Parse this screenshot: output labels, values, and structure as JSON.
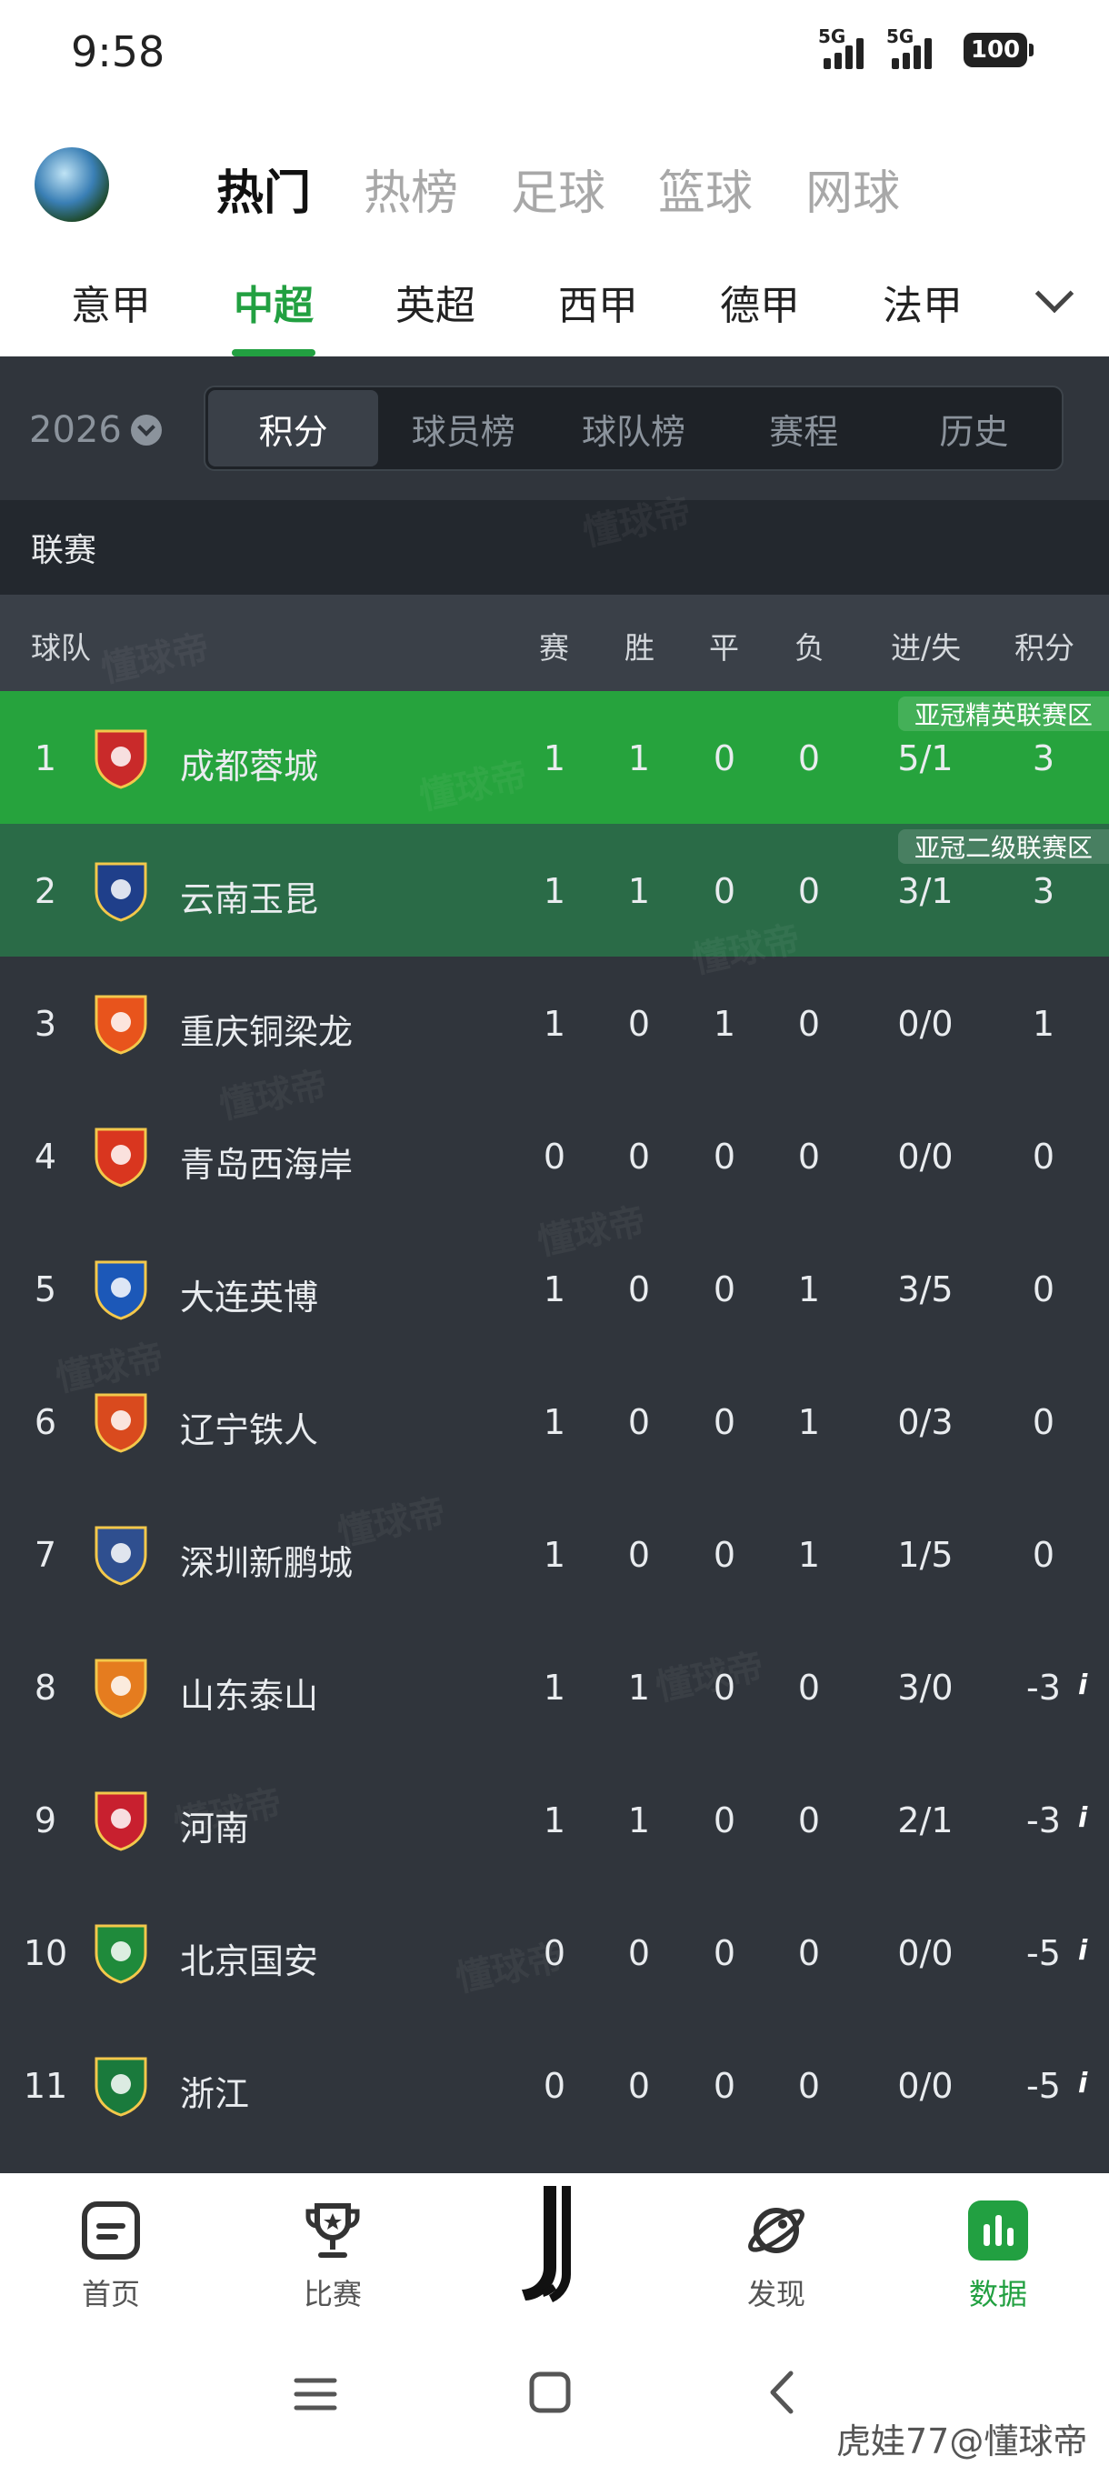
{
  "status": {
    "time": "9:58",
    "signal1": "5G",
    "signal2": "5G",
    "battery": "100"
  },
  "primary_tabs": [
    "热门",
    "热榜",
    "足球",
    "篮球",
    "网球"
  ],
  "league_tabs": [
    "意甲",
    "中超",
    "英超",
    "西甲",
    "德甲",
    "法甲"
  ],
  "season": "2026",
  "segments": [
    "积分",
    "球员榜",
    "球队榜",
    "赛程",
    "历史"
  ],
  "section_title": "联赛",
  "columns": {
    "team": "球队",
    "played": "赛",
    "won": "胜",
    "draw": "平",
    "lost": "负",
    "goals": "进/失",
    "points": "积分"
  },
  "rows": [
    {
      "rank": "1",
      "team": "成都蓉城",
      "played": "1",
      "won": "1",
      "draw": "0",
      "lost": "0",
      "goals": "5/1",
      "points": "3",
      "zone": "亚冠精英联赛区",
      "color": "#c92a2a"
    },
    {
      "rank": "2",
      "team": "云南玉昆",
      "played": "1",
      "won": "1",
      "draw": "0",
      "lost": "0",
      "goals": "3/1",
      "points": "3",
      "zone": "亚冠二级联赛区",
      "color": "#1f3f8a"
    },
    {
      "rank": "3",
      "team": "重庆铜梁龙",
      "played": "1",
      "won": "0",
      "draw": "1",
      "lost": "0",
      "goals": "0/0",
      "points": "1",
      "color": "#e8541c"
    },
    {
      "rank": "4",
      "team": "青岛西海岸",
      "played": "0",
      "won": "0",
      "draw": "0",
      "lost": "0",
      "goals": "0/0",
      "points": "0",
      "color": "#d9361f"
    },
    {
      "rank": "5",
      "team": "大连英博",
      "played": "1",
      "won": "0",
      "draw": "0",
      "lost": "1",
      "goals": "3/5",
      "points": "0",
      "color": "#1c58b8"
    },
    {
      "rank": "6",
      "team": "辽宁铁人",
      "played": "1",
      "won": "0",
      "draw": "0",
      "lost": "1",
      "goals": "0/3",
      "points": "0",
      "color": "#d94a1e"
    },
    {
      "rank": "7",
      "team": "深圳新鹏城",
      "played": "1",
      "won": "0",
      "draw": "0",
      "lost": "1",
      "goals": "1/5",
      "points": "0",
      "color": "#2f4f8f"
    },
    {
      "rank": "8",
      "team": "山东泰山",
      "played": "1",
      "won": "1",
      "draw": "0",
      "lost": "0",
      "goals": "3/0",
      "points": "-3",
      "info": "i",
      "color": "#e57c1f"
    },
    {
      "rank": "9",
      "team": "河南",
      "played": "1",
      "won": "1",
      "draw": "0",
      "lost": "0",
      "goals": "2/1",
      "points": "-3",
      "info": "i",
      "color": "#c8202f"
    },
    {
      "rank": "10",
      "team": "北京国安",
      "played": "0",
      "won": "0",
      "draw": "0",
      "lost": "0",
      "goals": "0/0",
      "points": "-5",
      "info": "i",
      "color": "#1f8a3b"
    },
    {
      "rank": "11",
      "team": "浙江",
      "played": "0",
      "won": "0",
      "draw": "0",
      "lost": "0",
      "goals": "0/0",
      "points": "-5",
      "info": "i",
      "color": "#1a7a3c"
    }
  ],
  "watermark": "懂球帝",
  "bottom_tabs": [
    {
      "label": "首页",
      "icon": "home-icon"
    },
    {
      "label": "比赛",
      "icon": "trophy-icon"
    },
    {
      "label": "",
      "icon": "juventus-logo-icon"
    },
    {
      "label": "发现",
      "icon": "planet-icon"
    },
    {
      "label": "数据",
      "icon": "data-chart-icon"
    }
  ],
  "credit": "虎娃77@懂球帝",
  "colors": {
    "accent": "#22a041",
    "zone1": "#26a33d",
    "zone2": "#2a6b47",
    "bg_dark": "#30353c"
  }
}
